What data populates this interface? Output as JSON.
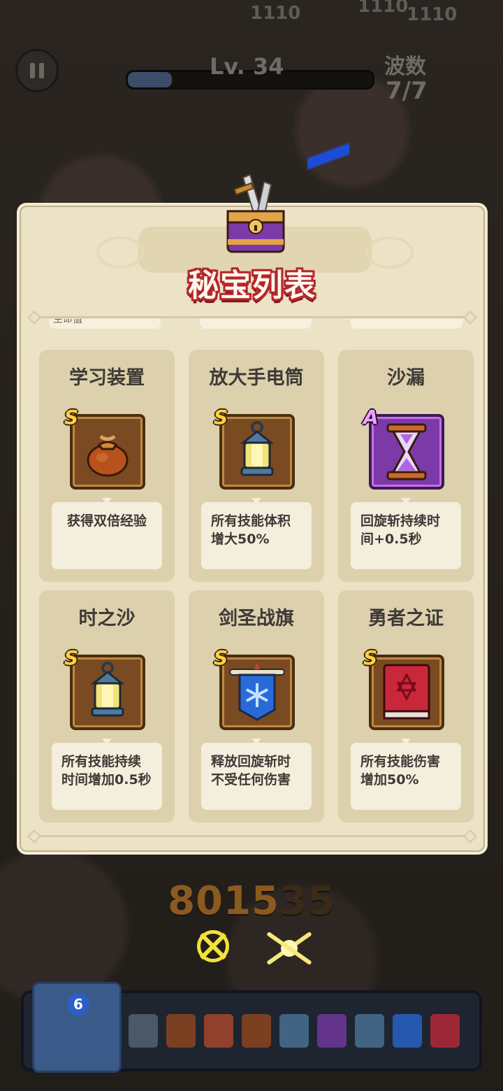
{
  "hud": {
    "level": "Lv. 34",
    "wave_label": "波数",
    "wave_value": "7/7",
    "hp_labels": [
      "1110",
      "1110",
      "1110"
    ],
    "xp_fill": 0.18
  },
  "panel": {
    "title": "秘宝列表",
    "peek_text": "生命值"
  },
  "cards": [
    {
      "name": "学习装置",
      "rank": "S",
      "icon": "treasure-bag-icon",
      "desc": "获得双倍经验",
      "align": "center"
    },
    {
      "name": "放大手电筒",
      "rank": "S",
      "icon": "lantern-icon",
      "desc": "所有技能体积增大50%",
      "align": "left"
    },
    {
      "name": "沙漏",
      "rank": "A",
      "icon": "hourglass-icon",
      "desc": "回旋斩持续时间+0.5秒",
      "align": "left"
    },
    {
      "name": "时之沙",
      "rank": "S",
      "icon": "lantern-icon",
      "desc": "所有技能持续时间增加0.5秒",
      "align": "left"
    },
    {
      "name": "剑圣战旗",
      "rank": "S",
      "icon": "banner-flag-icon",
      "desc": "释放回旋斩时不受任何伤害",
      "align": "left"
    },
    {
      "name": "勇者之证",
      "rank": "S",
      "icon": "red-tome-icon",
      "desc": "所有技能伤害增加50%",
      "align": "left"
    }
  ],
  "score": {
    "digits_dim": "8015",
    "digits_light": "35"
  },
  "skillbar": {
    "book_count": "6",
    "slots": [
      "armor-icon",
      "bag-icon",
      "crystal-icon",
      "bag-icon",
      "lantern-icon",
      "hourglass-icon",
      "lantern-icon",
      "banner-flag-icon",
      "red-tome-icon"
    ]
  }
}
